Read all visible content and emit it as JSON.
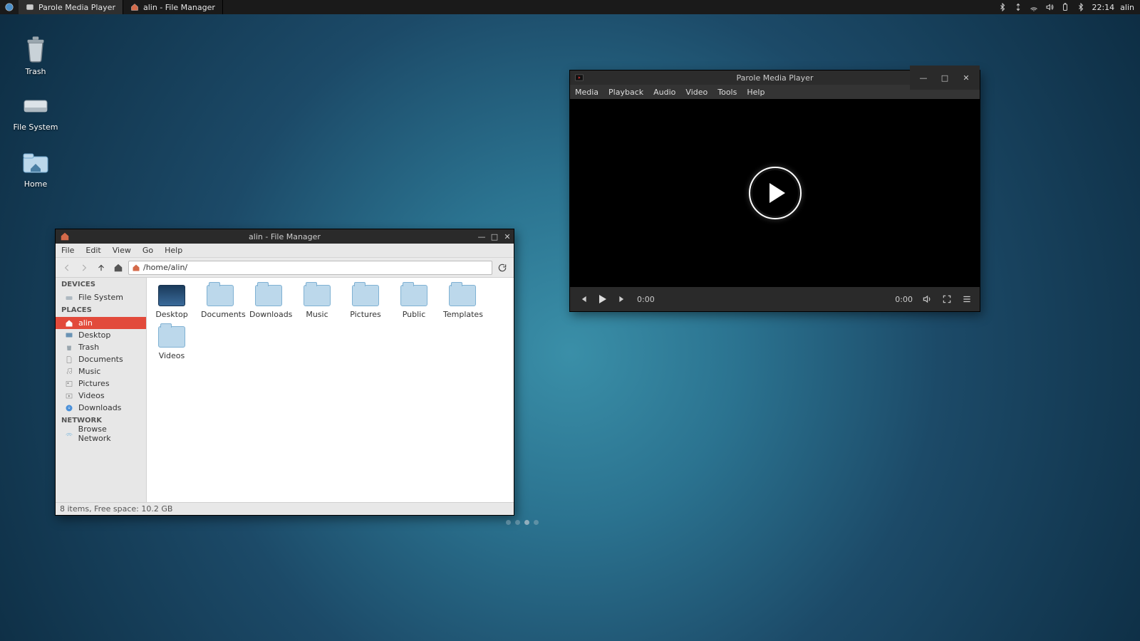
{
  "panel": {
    "tasks": [
      {
        "label": "Parole Media Player"
      },
      {
        "label": "alin - File Manager"
      }
    ],
    "time": "22:14",
    "user": "alin"
  },
  "desktop": {
    "icons": [
      {
        "label": "Trash"
      },
      {
        "label": "File System"
      },
      {
        "label": "Home"
      }
    ]
  },
  "filemanager": {
    "title": "alin - File Manager",
    "menu": [
      "File",
      "Edit",
      "View",
      "Go",
      "Help"
    ],
    "path": "/home/alin/",
    "sidebar": {
      "devices_head": "DEVICES",
      "devices": [
        {
          "label": "File System"
        }
      ],
      "places_head": "PLACES",
      "places": [
        {
          "label": "alin",
          "selected": true
        },
        {
          "label": "Desktop"
        },
        {
          "label": "Trash"
        },
        {
          "label": "Documents"
        },
        {
          "label": "Music"
        },
        {
          "label": "Pictures"
        },
        {
          "label": "Videos"
        },
        {
          "label": "Downloads"
        }
      ],
      "network_head": "NETWORK",
      "network": [
        {
          "label": "Browse Network"
        }
      ]
    },
    "folders": [
      "Desktop",
      "Documents",
      "Downloads",
      "Music",
      "Pictures",
      "Public",
      "Templates",
      "Videos"
    ],
    "status": "8 items, Free space: 10.2 GB"
  },
  "player": {
    "title": "Parole Media Player",
    "menu": [
      "Media",
      "Playback",
      "Audio",
      "Video",
      "Tools",
      "Help"
    ],
    "time_elapsed": "0:00",
    "time_total": "0:00"
  }
}
